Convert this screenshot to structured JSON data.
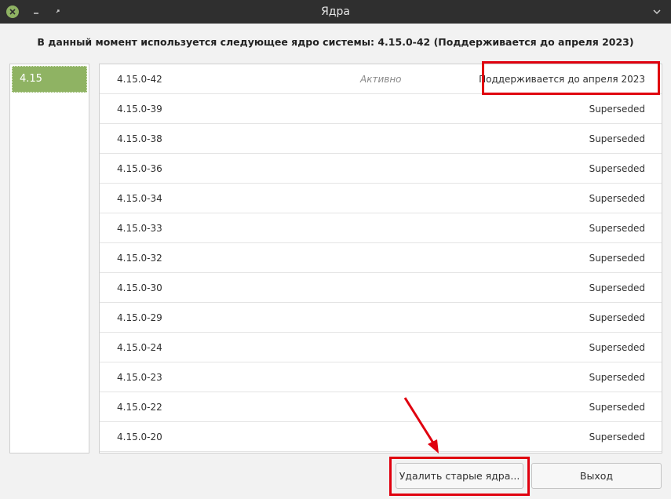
{
  "window": {
    "title": "Ядра",
    "icons": {
      "close": "close-icon",
      "minimize": "minimize-icon",
      "maximize": "maximize-icon",
      "menu": "chevron-down-icon"
    }
  },
  "headline": "В данный момент используется следующее ядро системы: 4.15.0-42 (Поддерживается до апреля 2023)",
  "series": {
    "items": [
      "4.15"
    ],
    "selected": 0
  },
  "kernels": [
    {
      "version": "4.15.0-42",
      "active": "Активно",
      "status": "Поддерживается до апреля 2023"
    },
    {
      "version": "4.15.0-39",
      "status": "Superseded"
    },
    {
      "version": "4.15.0-38",
      "status": "Superseded"
    },
    {
      "version": "4.15.0-36",
      "status": "Superseded"
    },
    {
      "version": "4.15.0-34",
      "status": "Superseded"
    },
    {
      "version": "4.15.0-33",
      "status": "Superseded"
    },
    {
      "version": "4.15.0-32",
      "status": "Superseded"
    },
    {
      "version": "4.15.0-30",
      "status": "Superseded"
    },
    {
      "version": "4.15.0-29",
      "status": "Superseded"
    },
    {
      "version": "4.15.0-24",
      "status": "Superseded"
    },
    {
      "version": "4.15.0-23",
      "status": "Superseded"
    },
    {
      "version": "4.15.0-22",
      "status": "Superseded"
    },
    {
      "version": "4.15.0-20",
      "status": "Superseded"
    }
  ],
  "buttons": {
    "remove": "Удалить старые ядра...",
    "exit": "Выход"
  },
  "colors": {
    "accent": "#8fb363",
    "titlebar": "#2f2f2f",
    "highlight": "#e0000f"
  }
}
